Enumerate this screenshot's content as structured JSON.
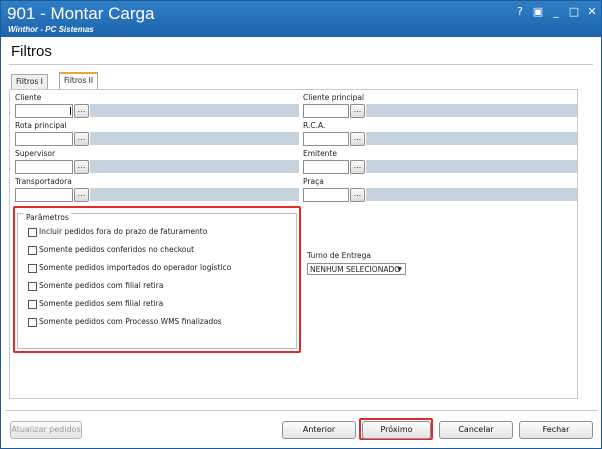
{
  "window": {
    "title": "901 - Montar Carga",
    "subtitle": "Winthor - PC Sistemas",
    "controls": [
      "?",
      "▣",
      "_",
      "□",
      "✕"
    ]
  },
  "page": {
    "title": "Filtros"
  },
  "tabs": [
    {
      "label": "Filtros I",
      "active": false
    },
    {
      "label": "Filtros II",
      "active": true
    }
  ],
  "fields": {
    "cliente": {
      "label": "Cliente",
      "value": ""
    },
    "cliente_principal": {
      "label": "Cliente principal",
      "value": ""
    },
    "rota_principal": {
      "label": "Rota principal",
      "value": ""
    },
    "rca": {
      "label": "R.C.A.",
      "value": ""
    },
    "supervisor": {
      "label": "Supervisor",
      "value": ""
    },
    "emitente": {
      "label": "Emitente",
      "value": ""
    },
    "transportadora": {
      "label": "Transportadora",
      "value": ""
    },
    "praca": {
      "label": "Praça",
      "value": ""
    },
    "lookup_button_label": "..."
  },
  "parametros": {
    "title": "Parâmetros",
    "options": [
      {
        "label": "Incluir pedidos fora do prazo de faturamento",
        "checked": false
      },
      {
        "label": "Somente pedidos conferidos no checkout",
        "checked": false
      },
      {
        "label": "Somente pedidos importados do operador logístico",
        "checked": false
      },
      {
        "label": "Somente pedidos com filial retira",
        "checked": false
      },
      {
        "label": "Somente pedidos sem filial retira",
        "checked": false
      },
      {
        "label": "Somente pedidos com Processo WMS finalizados",
        "checked": false
      }
    ]
  },
  "turno": {
    "label": "Turno de Entrega",
    "selected": "NENHUM SELECIONADO"
  },
  "buttons": {
    "atualizar": "Atualizar pedidos",
    "anterior": "Anterior",
    "proximo": "Próximo",
    "cancelar": "Cancelar",
    "fechar": "Fechar"
  },
  "colors": {
    "titlebar": "#1d64ad",
    "highlight": "#e02b2b",
    "tab_accent": "#e5a63a"
  }
}
